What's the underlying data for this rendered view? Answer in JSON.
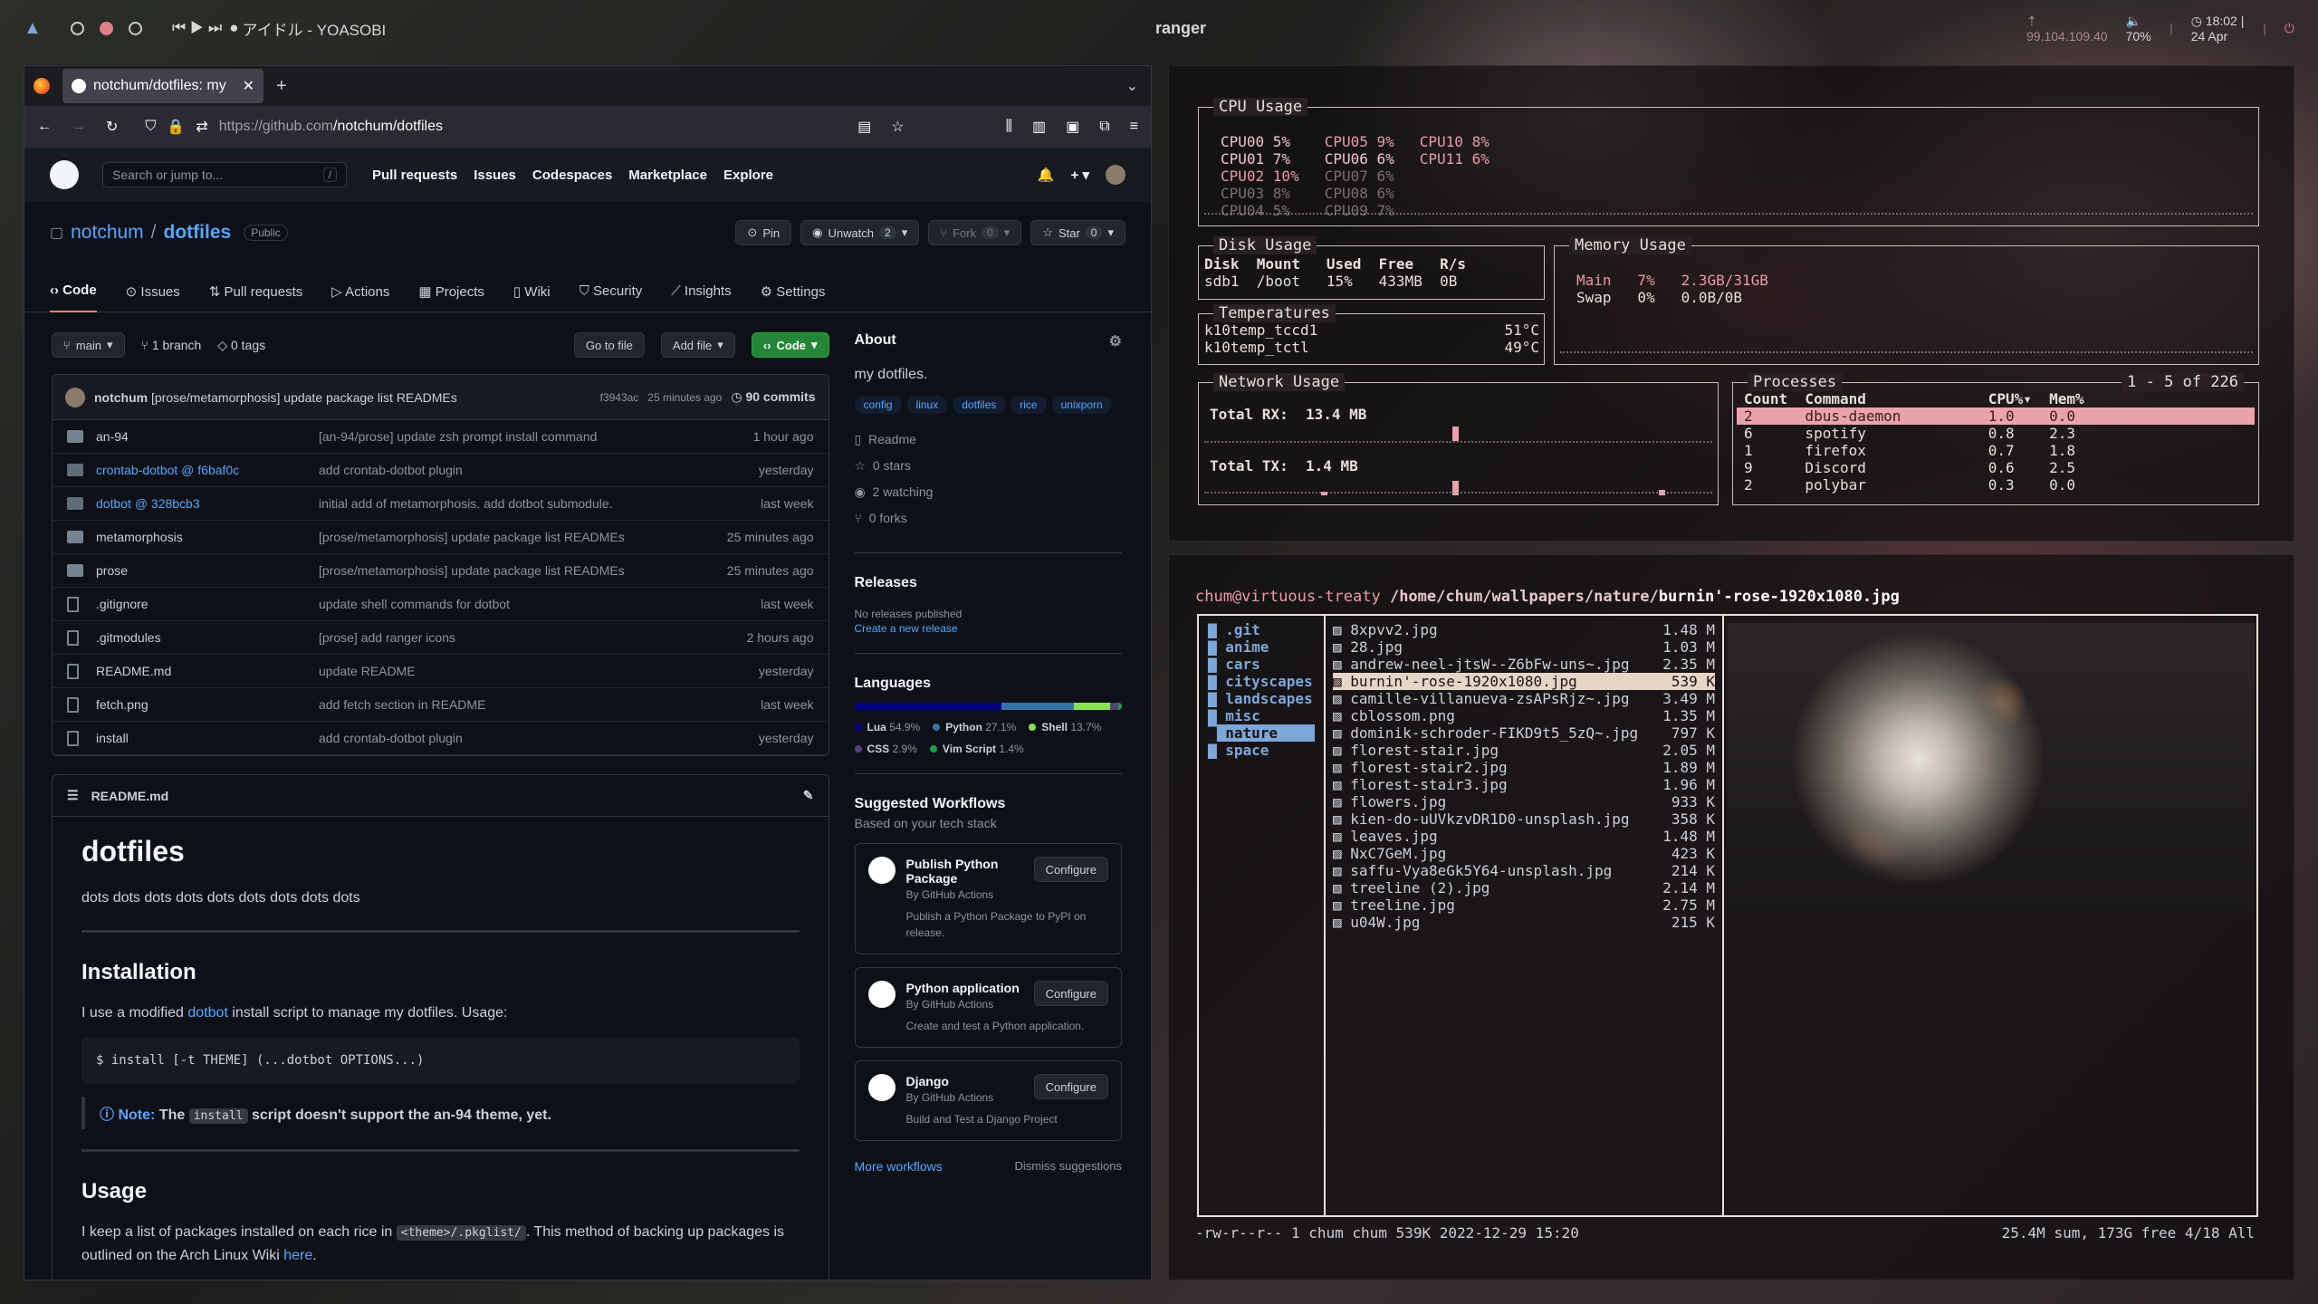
{
  "bar": {
    "media": "⏮ ▶ ⏭",
    "song": "アイドル - YOASOBI",
    "title": "ranger",
    "ip": "99.104.109.40",
    "volume": "70%",
    "time": "18:02 | 24 Apr"
  },
  "browser": {
    "tab_title": "notchum/dotfiles: my",
    "url": "https://github.com/notchum/dotfiles",
    "url_host": "https://github.com",
    "url_path": "/notchum/dotfiles"
  },
  "gh": {
    "search": "Search or jump to...",
    "search_key": "/",
    "nav": [
      "Pull requests",
      "Issues",
      "Codespaces",
      "Marketplace",
      "Explore"
    ],
    "owner": "notchum",
    "repo": "dotfiles",
    "visibility": "Public",
    "pin": "Pin",
    "unwatch": "Unwatch",
    "unwatch_count": "2",
    "fork": "Fork",
    "fork_count": "0",
    "star": "Star",
    "star_count": "0",
    "tabs": [
      "Code",
      "Issues",
      "Pull requests",
      "Actions",
      "Projects",
      "Wiki",
      "Security",
      "Insights",
      "Settings"
    ],
    "branch": "main",
    "branches": "1 branch",
    "tags": "0 tags",
    "goto": "Go to file",
    "addfile": "Add file",
    "code": "Code",
    "commit": {
      "author": "notchum",
      "msg": "[prose/metamorphosis] update package list READMEs",
      "hash": "f3943ac",
      "time": "25 minutes ago",
      "count": "90 commits"
    },
    "files": [
      {
        "name": "an-94",
        "msg": "[an-94/prose] update zsh prompt install command",
        "time": "1 hour ago"
      },
      {
        "name": "crontab-dotbot @ f6baf0c",
        "msg": "add crontab-dotbot plugin",
        "time": "yesterday"
      },
      {
        "name": "dotbot @ 328bcb3",
        "msg": "initial add of metamorphosis. add dotbot submodule.",
        "time": "last week"
      },
      {
        "name": "metamorphosis",
        "msg": "[prose/metamorphosis] update package list READMEs",
        "time": "25 minutes ago"
      },
      {
        "name": "prose",
        "msg": "[prose/metamorphosis] update package list READMEs",
        "time": "25 minutes ago"
      },
      {
        "name": ".gitignore",
        "msg": "update shell commands for dotbot",
        "time": "last week"
      },
      {
        "name": ".gitmodules",
        "msg": "[prose] add ranger icons",
        "time": "2 hours ago"
      },
      {
        "name": "README.md",
        "msg": "update README",
        "time": "yesterday"
      },
      {
        "name": "fetch.png",
        "msg": "add fetch section in README",
        "time": "last week"
      },
      {
        "name": "install",
        "msg": "add crontab-dotbot plugin",
        "time": "yesterday"
      }
    ],
    "readme": {
      "file": "README.md",
      "h1": "dotfiles",
      "p1": "dots dots dots dots dots dots dots dots dots",
      "h2a": "Installation",
      "p2a": "I use a modified ",
      "p2link": "dotbot",
      "p2b": " install script to manage my dotfiles. Usage:",
      "code": "$ install [-t THEME] (...dotbot OPTIONS...)",
      "note_lbl": "Note:",
      "note_a": " The ",
      "note_code": "install",
      "note_b": " script doesn't support the an-94 theme, yet.",
      "h2b": "Usage",
      "p3a": "I keep a list of packages installed on each rice in ",
      "p3code": "<theme>/.pkglist/",
      "p3b": ". This method of backing up packages is outlined on the Arch Linux Wiki ",
      "p3link": "here",
      "p3c": "."
    },
    "about": {
      "title": "About",
      "desc": "my dotfiles.",
      "topics": [
        "config",
        "linux",
        "dotfiles",
        "rice",
        "unixporn"
      ],
      "readme": "Readme",
      "stars": "0 stars",
      "watching": "2 watching",
      "forks": "0 forks"
    },
    "releases": {
      "title": "Releases",
      "none": "No releases published",
      "create": "Create a new release"
    },
    "languages": {
      "title": "Languages",
      "items": [
        {
          "name": "Lua",
          "pct": "54.9%",
          "val": 54.9,
          "color": "#000080"
        },
        {
          "name": "Python",
          "pct": "27.1%",
          "val": 27.1,
          "color": "#3572A5"
        },
        {
          "name": "Shell",
          "pct": "13.7%",
          "val": 13.7,
          "color": "#89e051"
        },
        {
          "name": "CSS",
          "pct": "2.9%",
          "val": 2.9,
          "color": "#563d7c"
        },
        {
          "name": "Vim Script",
          "pct": "1.4%",
          "val": 1.4,
          "color": "#199f4b"
        }
      ]
    },
    "workflows": {
      "title": "Suggested Workflows",
      "sub": "Based on your tech stack",
      "configure": "Configure",
      "by": "By GitHub Actions",
      "items": [
        {
          "name": "Publish Python Package",
          "desc": "Publish a Python Package to PyPI on release."
        },
        {
          "name": "Python application",
          "desc": "Create and test a Python application."
        },
        {
          "name": "Django",
          "desc": "Build and Test a Django Project"
        }
      ],
      "more": "More workflows",
      "dismiss": "Dismiss suggestions"
    }
  },
  "btop": {
    "cpu_title": "CPU Usage",
    "cpu_col1": [
      "CPU00 5%",
      "CPU01 7%",
      "CPU02 10%",
      "CPU03 8%",
      "CPU04 5%"
    ],
    "cpu_col2": [
      "CPU05 9%",
      "CPU06 6%",
      "CPU07 6%",
      "CPU08 6%",
      "CPU09 7%"
    ],
    "cpu_col3": [
      "CPU10 8%",
      "CPU11 6%"
    ],
    "disk_title": "Disk Usage",
    "disk_head": "Disk  Mount   Used  Free   R/s",
    "disk_row": "sdb1  /boot   15%   433MB  0B",
    "mem_title": "Memory Usage",
    "mem_main": "Main   7%   2.3GB/31GB",
    "mem_swap": "Swap   0%   0.0B/0B",
    "temp_title": "Temperatures",
    "temp1": "k10temp_tccd1",
    "temp1v": "51°C",
    "temp2": "k10temp_tctl",
    "temp2v": "49°C",
    "net_title": "Network Usage",
    "rx": "Total RX:  13.4 MB",
    "tx": "Total TX:  1.4 MB",
    "proc_title": "Processes",
    "proc_count": "1 - 5 of 226",
    "proc_head": "Count  Command              CPU%▾  Mem%",
    "procs": [
      "2      dbus-daemon          1.0    0.0",
      "6      spotify              0.8    2.3",
      "1      firefox              0.7    1.8",
      "9      Discord              0.6    2.5",
      "2      polybar              0.3    0.0"
    ]
  },
  "ranger": {
    "host": "chum@virtuous-treaty",
    "path": "/home/chum/wallpapers/nature/",
    "file": "burnin'-rose-1920x1080.jpg",
    "dirs": [
      ".git",
      "anime",
      "cars",
      "cityscapes",
      "landscapes",
      "misc",
      "nature",
      "space"
    ],
    "files": [
      [
        "8xpvv2.jpg",
        "1.48 M"
      ],
      [
        "28.jpg",
        "1.03 M"
      ],
      [
        "andrew-neel-jtsW--Z6bFw-uns~.jpg",
        "2.35 M"
      ],
      [
        "burnin'-rose-1920x1080.jpg",
        "539 K"
      ],
      [
        "camille-villanueva-zsAPsRjz~.jpg",
        "3.49 M"
      ],
      [
        "cblossom.png",
        "1.35 M"
      ],
      [
        "dominik-schroder-FIKD9t5_5zQ~.jpg",
        "797 K"
      ],
      [
        "florest-stair.jpg",
        "2.05 M"
      ],
      [
        "florest-stair2.jpg",
        "1.89 M"
      ],
      [
        "florest-stair3.jpg",
        "1.96 M"
      ],
      [
        "flowers.jpg",
        "933 K"
      ],
      [
        "kien-do-uUVkzvDR1D0-unsplash.jpg",
        "358 K"
      ],
      [
        "leaves.jpg",
        "1.48 M"
      ],
      [
        "NxC7GeM.jpg",
        "423 K"
      ],
      [
        "saffu-Vya8eGk5Y64-unsplash.jpg",
        "214 K"
      ],
      [
        "treeline (2).jpg",
        "2.14 M"
      ],
      [
        "treeline.jpg",
        "2.75 M"
      ],
      [
        "u04W.jpg",
        "215 K"
      ]
    ],
    "status_left": "-rw-r--r-- 1 chum chum 539K 2022-12-29 15:20",
    "status_right": "25.4M sum, 173G free  4/18  All"
  }
}
